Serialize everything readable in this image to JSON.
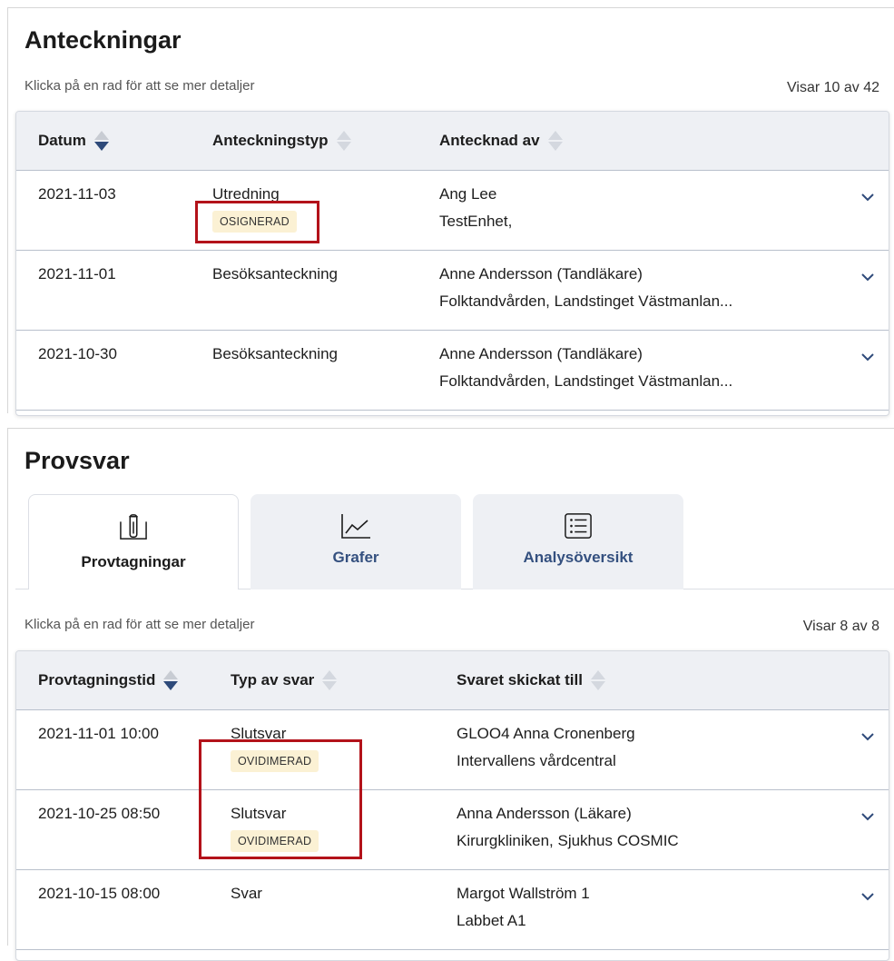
{
  "notes": {
    "title": "Anteckningar",
    "hint": "Klicka på en rad för att se mer detaljer",
    "count": "Visar 10 av 42",
    "columns": [
      "Datum",
      "Anteckningstyp",
      "Antecknad av"
    ],
    "rows": [
      {
        "date": "2021-11-03",
        "type": "Utredning",
        "badge": "OSIGNERAD",
        "author": "Ang Lee",
        "unit": "TestEnhet,"
      },
      {
        "date": "2021-11-01",
        "type": "Besöksanteckning",
        "author": "Anne Andersson (Tandläkare)",
        "unit": "Folktandvården, Landstinget Västmanlan..."
      },
      {
        "date": "2021-10-30",
        "type": "Besöksanteckning",
        "author": "Anne Andersson (Tandläkare)",
        "unit": "Folktandvården, Landstinget Västmanlan..."
      }
    ]
  },
  "labs": {
    "title": "Provsvar",
    "tabs": [
      {
        "label": "Provtagningar",
        "icon": "test-tube-icon",
        "active": true
      },
      {
        "label": "Grafer",
        "icon": "line-chart-icon",
        "active": false
      },
      {
        "label": "Analysöversikt",
        "icon": "list-icon",
        "active": false
      }
    ],
    "hint": "Klicka på en rad för att se mer detaljer",
    "count": "Visar 8 av 8",
    "columns": [
      "Provtagningstid",
      "Typ av svar",
      "Svaret skickat till"
    ],
    "rows": [
      {
        "time": "2021-11-01 10:00",
        "type": "Slutsvar",
        "badge": "OVIDIMERAD",
        "to": "GLOO4 Anna Cronenberg",
        "unit": "Intervallens vårdcentral"
      },
      {
        "time": "2021-10-25 08:50",
        "type": "Slutsvar",
        "badge": "OVIDIMERAD",
        "to": "Anna Andersson (Läkare)",
        "unit": "Kirurgkliniken, Sjukhus COSMIC"
      },
      {
        "time": "2021-10-15 08:00",
        "type": "Svar",
        "to": "Margot Wallström 1",
        "unit": "Labbet A1"
      }
    ]
  },
  "colors": {
    "accent": "#2e4a7a",
    "badge_bg": "#fbf1d4",
    "highlight": "#b3121a"
  }
}
